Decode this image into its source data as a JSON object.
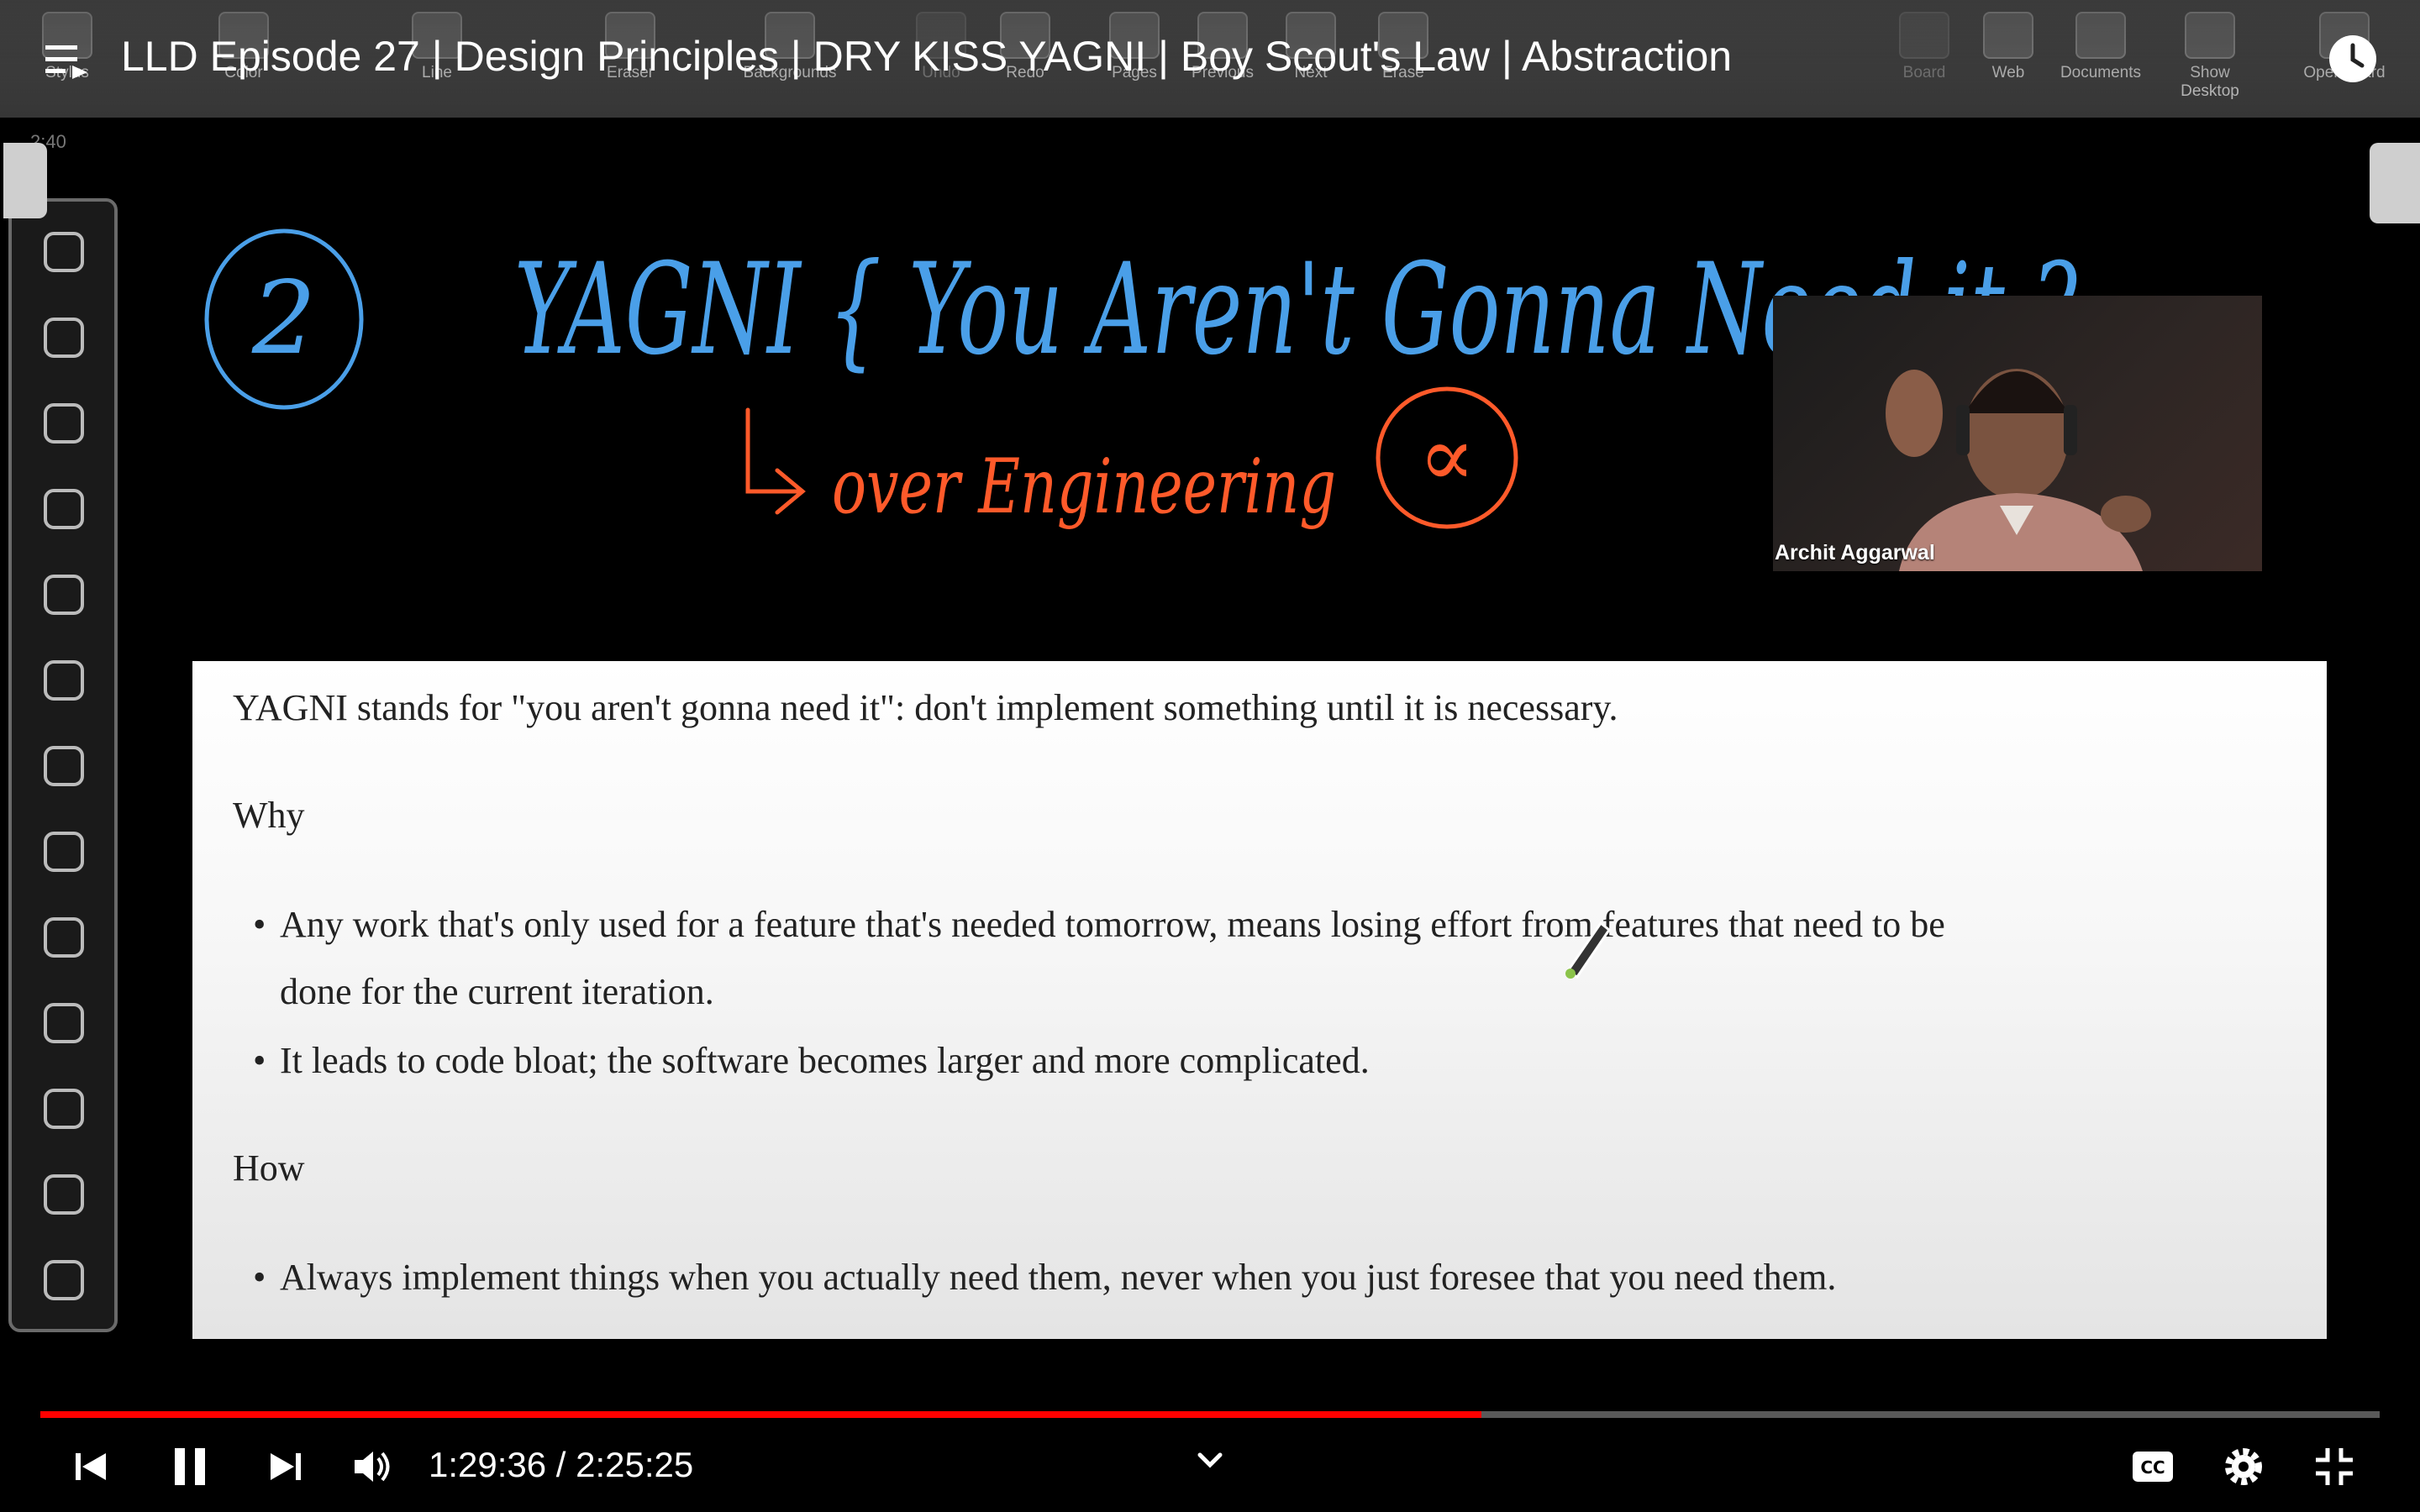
{
  "video_title": "LLD Episode 27 | Design Principles | DRY KISS YAGNI | Boy Scout's Law | Abstraction",
  "openboard": {
    "timecode": "2:40",
    "top_tools": [
      {
        "label": "Stylus",
        "dim": false
      },
      {
        "label": "Color",
        "dim": false
      },
      {
        "label": "Line",
        "dim": false
      },
      {
        "label": "Eraser",
        "dim": false
      },
      {
        "label": "Backgrounds",
        "dim": false
      },
      {
        "label": "Undo",
        "dim": true
      },
      {
        "label": "Redo",
        "dim": false
      },
      {
        "label": "Pages",
        "dim": false
      },
      {
        "label": "Previous",
        "dim": false
      },
      {
        "label": "Next",
        "dim": false
      },
      {
        "label": "Erase",
        "dim": false
      },
      {
        "label": "Board",
        "dim": true
      },
      {
        "label": "Web",
        "dim": false
      },
      {
        "label": "Documents",
        "dim": false
      },
      {
        "label": "Show Desktop",
        "dim": false
      },
      {
        "label": "OpenBoard",
        "dim": false
      }
    ],
    "left_tools": [
      "pen-icon",
      "eraser-icon",
      "marker-icon",
      "pointer-icon",
      "laser-pointer-icon",
      "hand-icon",
      "zoom-in-icon",
      "zoom-out-icon",
      "capture-pen-icon",
      "line-icon",
      "text-icon",
      "grid-icon",
      "keyboard-icon"
    ]
  },
  "handwriting": {
    "number": "2",
    "title": "YAGNI { You Aren't Gonna Need it ?",
    "subtitle": "over Engineering",
    "proportional_symbol": "∝",
    "colors": {
      "blue": "#4a9fe8",
      "orange": "#ff5a2a"
    }
  },
  "webcam": {
    "name": "Archit Aggarwal"
  },
  "slide": {
    "intro": "YAGNI stands for \"you aren't gonna need it\": don't implement something until it is necessary.",
    "why_heading": "Why",
    "why_bullets": [
      {
        "line1": "Any work that's only used for a feature that's needed tomorrow, means losing effort from features that need to be",
        "line2": "done for the current iteration."
      },
      {
        "line1": "It leads to code bloat; the software becomes larger and more complicated.",
        "line2": ""
      }
    ],
    "how_heading": "How",
    "how_bullets": [
      "Always implement things when you actually need them, never when you just foresee that you need them."
    ]
  },
  "player": {
    "current_time": "1:29:36",
    "duration": "2:25:25",
    "time_display": "1:29:36 / 2:25:25",
    "progress_fraction": 0.616,
    "accent_color": "#ff0000"
  }
}
